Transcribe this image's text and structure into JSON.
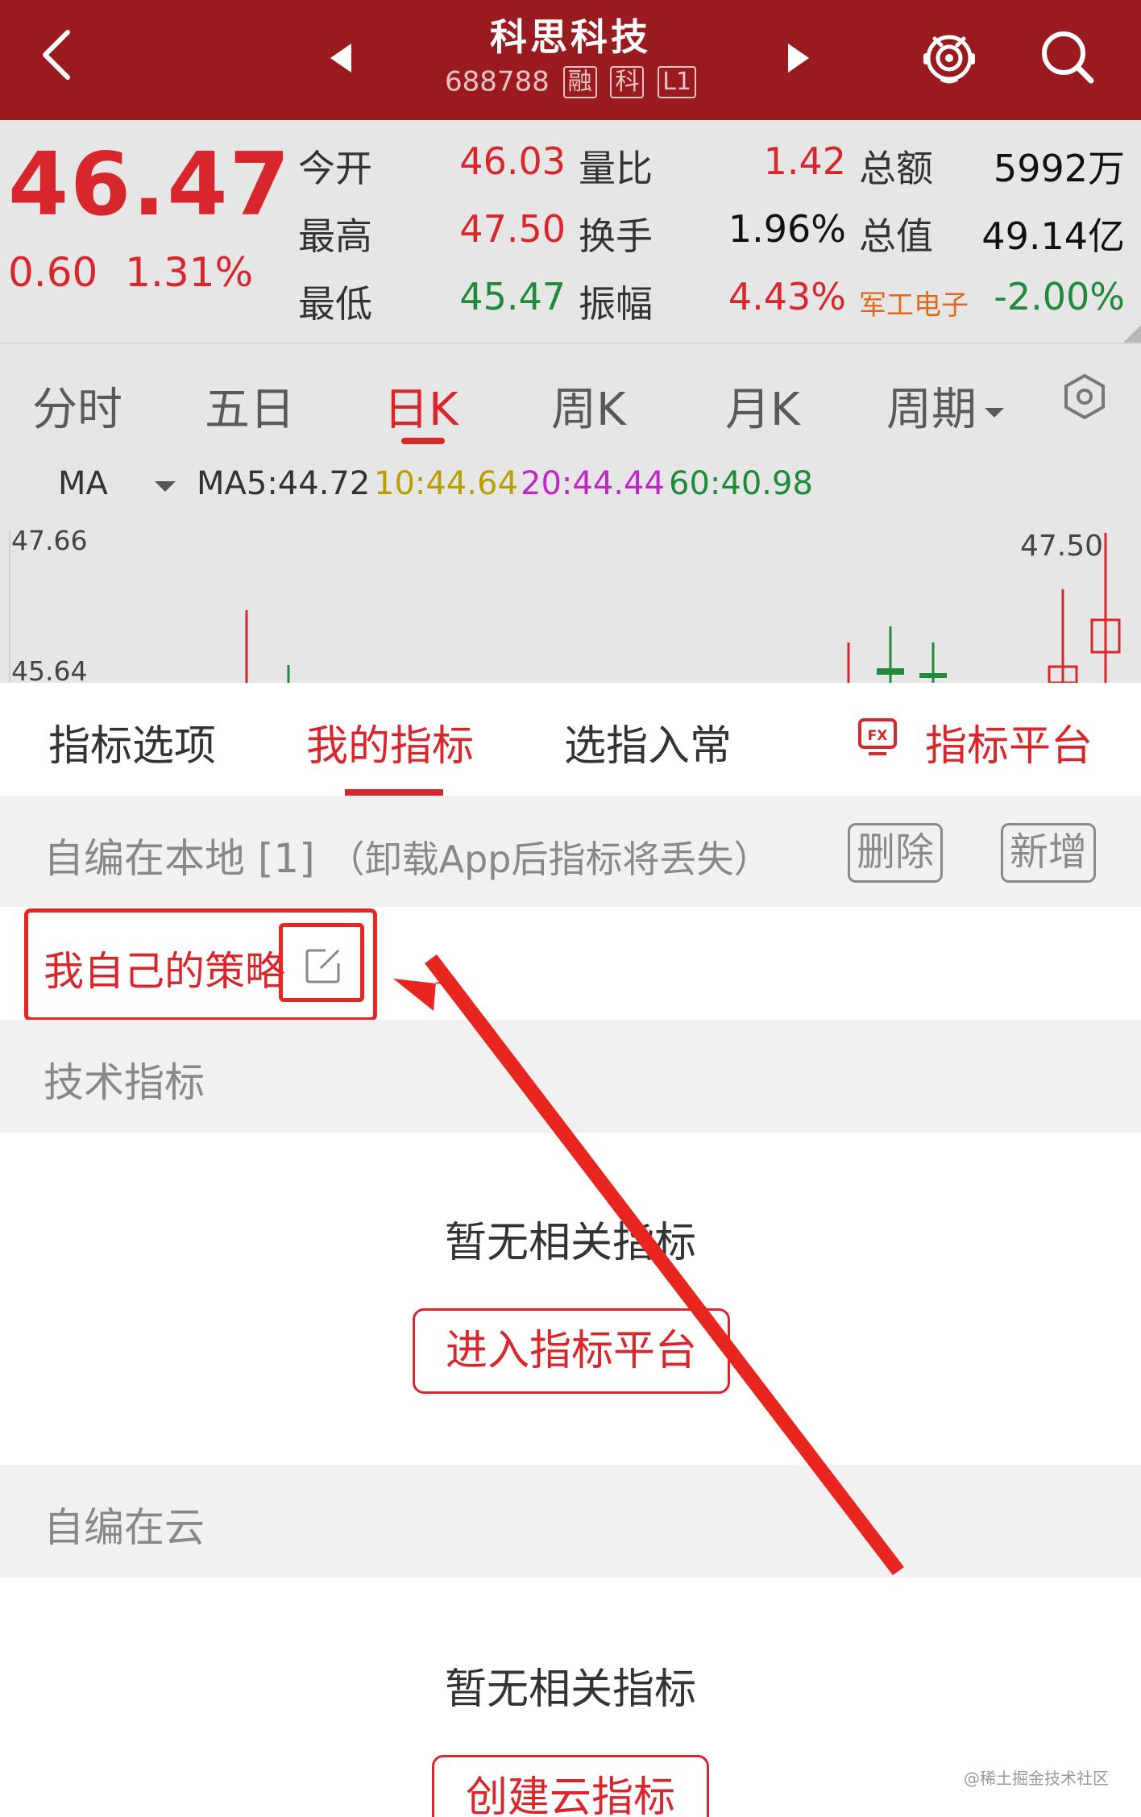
{
  "header": {
    "stock_name": "科思科技",
    "stock_code": "688788",
    "badges": [
      "融",
      "科",
      "L1"
    ]
  },
  "quote": {
    "price": "46.47",
    "change": "0.60",
    "change_pct": "1.31%",
    "rows": [
      [
        {
          "label": "今开",
          "value": "46.03",
          "color": "red"
        },
        {
          "label": "量比",
          "value": "1.42",
          "color": "red"
        },
        {
          "label": "总额",
          "value": "5992万",
          "color": "black"
        }
      ],
      [
        {
          "label": "最高",
          "value": "47.50",
          "color": "red"
        },
        {
          "label": "换手",
          "value": "1.96%",
          "color": "black"
        },
        {
          "label": "总值",
          "value": "49.14亿",
          "color": "black"
        }
      ],
      [
        {
          "label": "最低",
          "value": "45.47",
          "color": "green"
        },
        {
          "label": "振幅",
          "value": "4.43%",
          "color": "red"
        },
        {
          "label": "军工电子",
          "value": "-2.00%",
          "color": "green"
        }
      ]
    ]
  },
  "chart_tabs": {
    "items": [
      "分时",
      "五日",
      "日K",
      "周K",
      "月K",
      "周期"
    ],
    "active": "日K"
  },
  "ma": {
    "label": "MA",
    "ma5": "MA5:44.72",
    "ma10": "10:44.64",
    "ma20": "20:44.44",
    "ma60": "60:40.98",
    "colors": {
      "ma5": "#333333",
      "ma10": "#b7a000",
      "ma20": "#c026c8",
      "ma60": "#1e8a3a"
    }
  },
  "kchart": {
    "y_top_label": "47.66",
    "y_bottom_label": "45.64",
    "high_label": "47.50"
  },
  "sheet": {
    "tabs": [
      "指标选项",
      "我的指标",
      "选指入常"
    ],
    "active_tab": "我的指标",
    "platform_label": "指标平台",
    "local": {
      "title": "自编在本地",
      "count": "[1]",
      "note": "（卸载App后指标将丢失）",
      "delete_label": "删除",
      "add_label": "新增"
    },
    "strategy_name": "我自己的策略",
    "tech": {
      "title": "技术指标",
      "empty_text": "暂无相关指标",
      "button": "进入指标平台"
    },
    "cloud": {
      "title": "自编在云",
      "empty_text": "暂无相关指标",
      "button": "创建云指标"
    }
  },
  "watermark": "@稀土掘金技术社区",
  "colors": {
    "brand_red": "#9a1b1f",
    "accent_red": "#d7262c",
    "annotation_red": "#e8251f"
  }
}
